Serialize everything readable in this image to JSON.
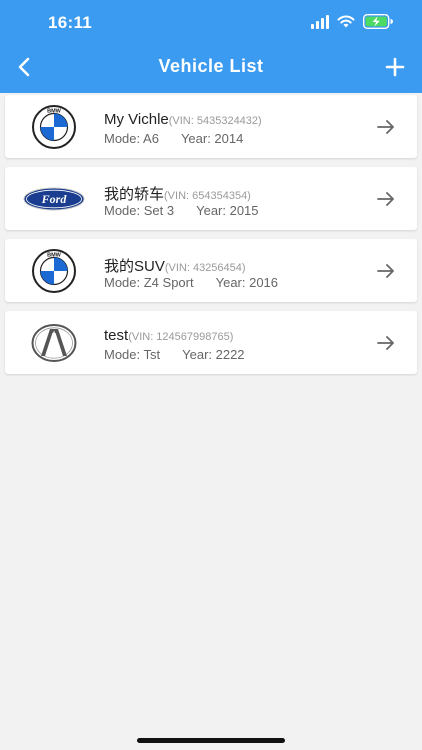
{
  "status_bar": {
    "time": "16:11"
  },
  "nav": {
    "title": "Vehicle List"
  },
  "vehicles": [
    {
      "name": "My Vichle",
      "vin": "(VIN: 5435324432)",
      "mode": "Mode: A6",
      "year": "Year: 2014",
      "logo": "bmw-logo"
    },
    {
      "name": "我的轿车",
      "vin": "(VIN: 654354354)",
      "mode": "Mode: Set 3",
      "year": "Year: 2015",
      "logo": "ford-logo"
    },
    {
      "name": "我的SUV",
      "vin": "(VIN: 43256454)",
      "mode": "Mode: Z4 Sport",
      "year": "Year: 2016",
      "logo": "bmw-logo"
    },
    {
      "name": "test",
      "vin": "(VIN: 124567998765)",
      "mode": "Mode: Tst",
      "year": "Year: 2222",
      "logo": "acura-logo"
    }
  ],
  "brand_logo_text": {
    "bmw": "BMW",
    "ford": "Ford"
  },
  "colors": {
    "header": "#3b9bf0",
    "background": "#f2f2f2",
    "battery": "#4cd964",
    "ford_blue": "#1a3d8f",
    "bmw_blue": "#1c69d4"
  }
}
